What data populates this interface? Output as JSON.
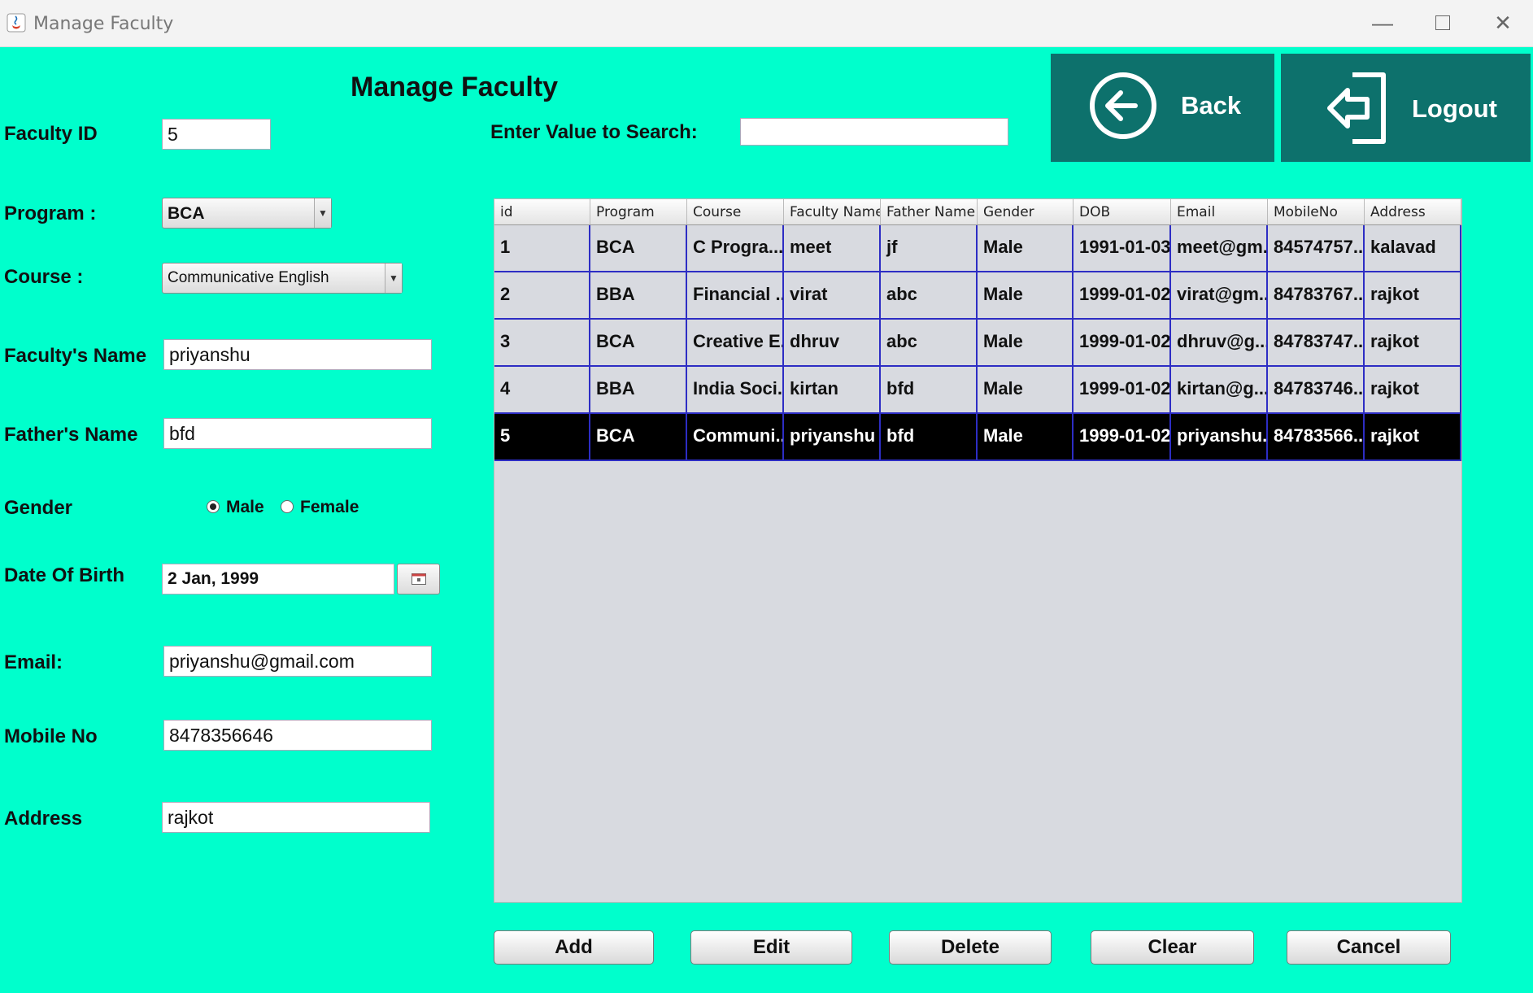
{
  "window": {
    "title": "Manage Faculty"
  },
  "heading": "Manage Faculty",
  "form": {
    "faculty_id_label": "Faculty ID",
    "faculty_id_value": "5",
    "program_label": "Program :",
    "program_value": "BCA",
    "course_label": "Course :",
    "course_value": "Communicative English",
    "faculty_name_label": "Faculty's Name",
    "faculty_name_value": "priyanshu",
    "father_name_label": "Father's Name",
    "father_name_value": "bfd",
    "gender_label": "Gender",
    "gender_options": [
      "Male",
      "Female"
    ],
    "gender_selected": "Male",
    "dob_label": "Date Of Birth",
    "dob_value": "2 Jan, 1999",
    "email_label": "Email:",
    "email_value": "priyanshu@gmail.com",
    "mobile_label": "Mobile No",
    "mobile_value": "8478356646",
    "address_label": "Address",
    "address_value": "rajkot"
  },
  "search": {
    "label": "Enter Value to Search:",
    "value": ""
  },
  "nav": {
    "back_label": "Back",
    "logout_label": "Logout"
  },
  "table": {
    "columns": [
      "id",
      "Program",
      "Course",
      "Faculty Name",
      "Father Name",
      "Gender",
      "DOB",
      "Email",
      "MobileNo",
      "Address"
    ],
    "rows": [
      [
        "1",
        "BCA",
        "C Progra...",
        "meet",
        "jf",
        "Male",
        "1991-01-03",
        "meet@gm...",
        "84574757...",
        "kalavad"
      ],
      [
        "2",
        "BBA",
        "Financial ...",
        "virat",
        "abc",
        "Male",
        "1999-01-02",
        "virat@gm...",
        "84783767...",
        "rajkot"
      ],
      [
        "3",
        "BCA",
        "Creative E...",
        "dhruv",
        "abc",
        "Male",
        "1999-01-02",
        "dhruv@g...",
        "84783747...",
        "rajkot"
      ],
      [
        "4",
        "BBA",
        "India Soci...",
        "kirtan",
        "bfd",
        "Male",
        "1999-01-02",
        "kirtan@g...",
        "84783746...",
        "rajkot"
      ],
      [
        "5",
        "BCA",
        "Communi...",
        "priyanshu",
        "bfd",
        "Male",
        "1999-01-02",
        "priyanshu...",
        "84783566...",
        "rajkot"
      ]
    ],
    "selected_row": "5"
  },
  "actions": {
    "add": "Add",
    "edit": "Edit",
    "delete": "Delete",
    "clear": "Clear",
    "cancel": "Cancel"
  },
  "colors": {
    "background": "#00ffcc",
    "nav_button": "#0d716c",
    "table_grid": "#2d2dc4",
    "selected_row": "#000000"
  }
}
